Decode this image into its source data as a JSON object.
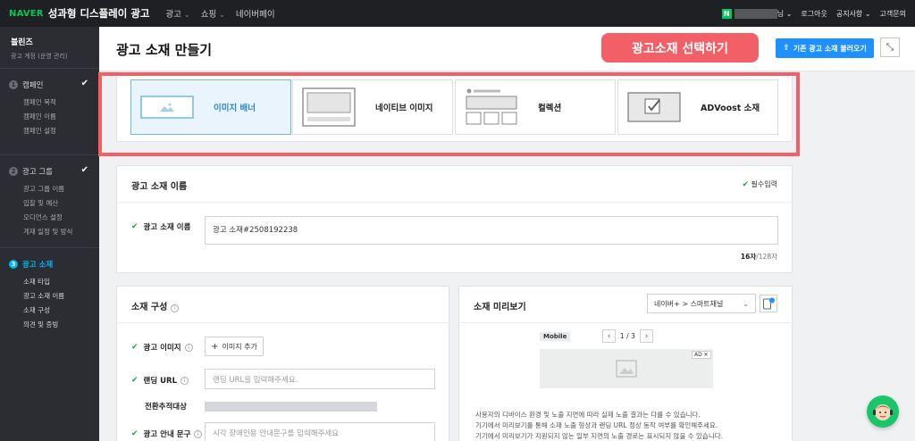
{
  "topbar": {
    "logo": "NAVER",
    "product": "성과형 디스플레이 광고",
    "nav": [
      "광고",
      "쇼핑",
      "네이버페이"
    ],
    "user_suffix": "님",
    "links": [
      "로그아웃",
      "공지사항",
      "고객문의"
    ]
  },
  "sidebar": {
    "account_name": "블린즈",
    "account_role": "광고 계정 (운영 관리)",
    "sections": [
      {
        "num": "1",
        "title": "캠페인",
        "items": [
          "캠페인 목적",
          "캠페인 이름",
          "캠페인 설정"
        ]
      },
      {
        "num": "2",
        "title": "광고 그룹",
        "items": [
          "광고 그룹 이름",
          "입찰 및 예산",
          "오디언스 설정",
          "게재 일정 및 방식"
        ]
      },
      {
        "num": "3",
        "title": "광고 소재",
        "items": [
          "소재 타입",
          "광고 소재 이름",
          "소재 구성",
          "의견 및 증빙"
        ]
      }
    ]
  },
  "header": {
    "title": "광고 소재 만들기",
    "annotation": "광고소재 선택하기",
    "load_button": "기존 광고 소재 불러오기"
  },
  "types": [
    "이미지 배너",
    "네이티브 이미지",
    "컬렉션",
    "ADVoost 소재"
  ],
  "name_panel": {
    "title": "광고 소재 이름",
    "required": "필수입력",
    "label": "광고 소재 이름",
    "value": "광고 소재#2508192238",
    "count": "16자",
    "max": "/128자"
  },
  "compose_panel": {
    "title": "소재 구성",
    "image_label": "광고 이미지",
    "add_image": "이미지 추가",
    "url_label": "랜딩 URL",
    "url_placeholder": "랜딩 URL을 입력해주세요.",
    "tracking_label": "전환추적대상",
    "guide_label": "광고 안내 문구",
    "guide_placeholder": "시각 장애인용 안내문구를 입력해주세요"
  },
  "preview_panel": {
    "title": "소재 미리보기",
    "placement": "네이버+ > 스마트채널",
    "device": "Mobile",
    "page": "1 / 3",
    "ad_tag": "AD",
    "notes": [
      "사용자의 디바이스 환경 및 노출 지면에 따라 실제 노출 결과는 다를 수 있습니다.",
      "기기에서 미리보기를 통해 소재 노출 형상과 랜딩 URL 정상 동작 여부를 확인해주세요.",
      "기기에서 미리보기가 지원되지 않는 일부 지면의 노출 경로는 표시되지 않을 수 있습니다."
    ]
  }
}
